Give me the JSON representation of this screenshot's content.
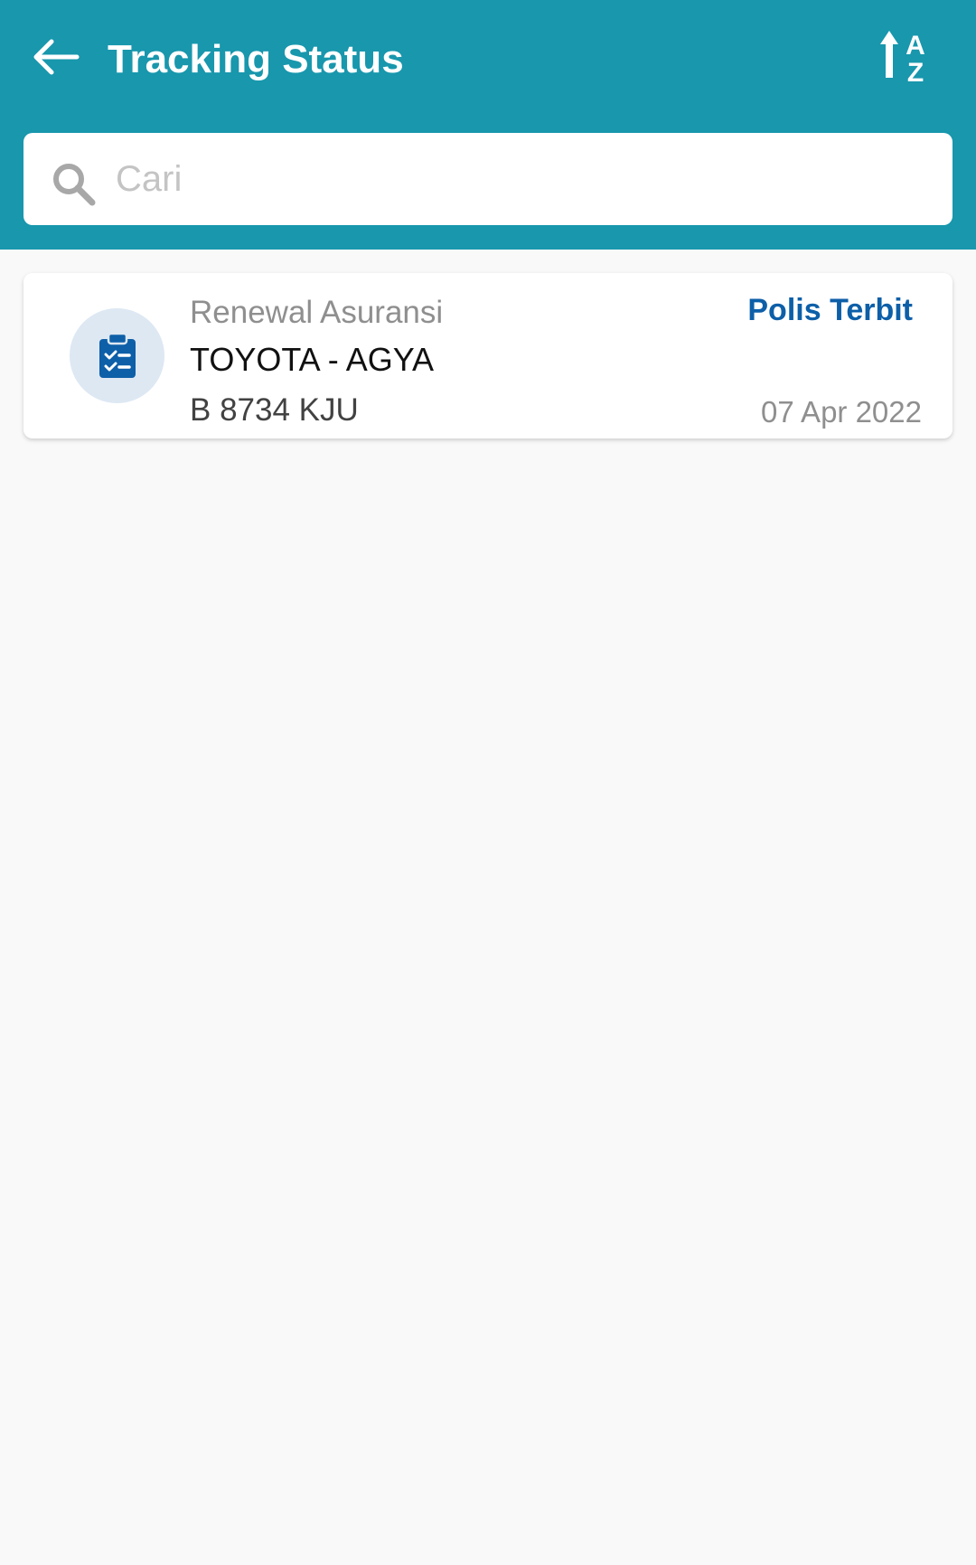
{
  "header": {
    "title": "Tracking Status",
    "back_icon": "arrow-left-icon",
    "sort_icon": "sort-alpha-icon",
    "sort_letters": [
      "A",
      "Z"
    ],
    "background_color": "#1897ad"
  },
  "search": {
    "placeholder": "Cari",
    "value": "",
    "icon": "search-icon"
  },
  "items": [
    {
      "icon": "clipboard-checklist-icon",
      "category": "Renewal Asuransi",
      "name": "TOYOTA - AGYA",
      "plate": "B 8734 KJU",
      "status": "Polis Terbit",
      "date": "07 Apr 2022",
      "status_color": "#0d5fa8"
    }
  ]
}
